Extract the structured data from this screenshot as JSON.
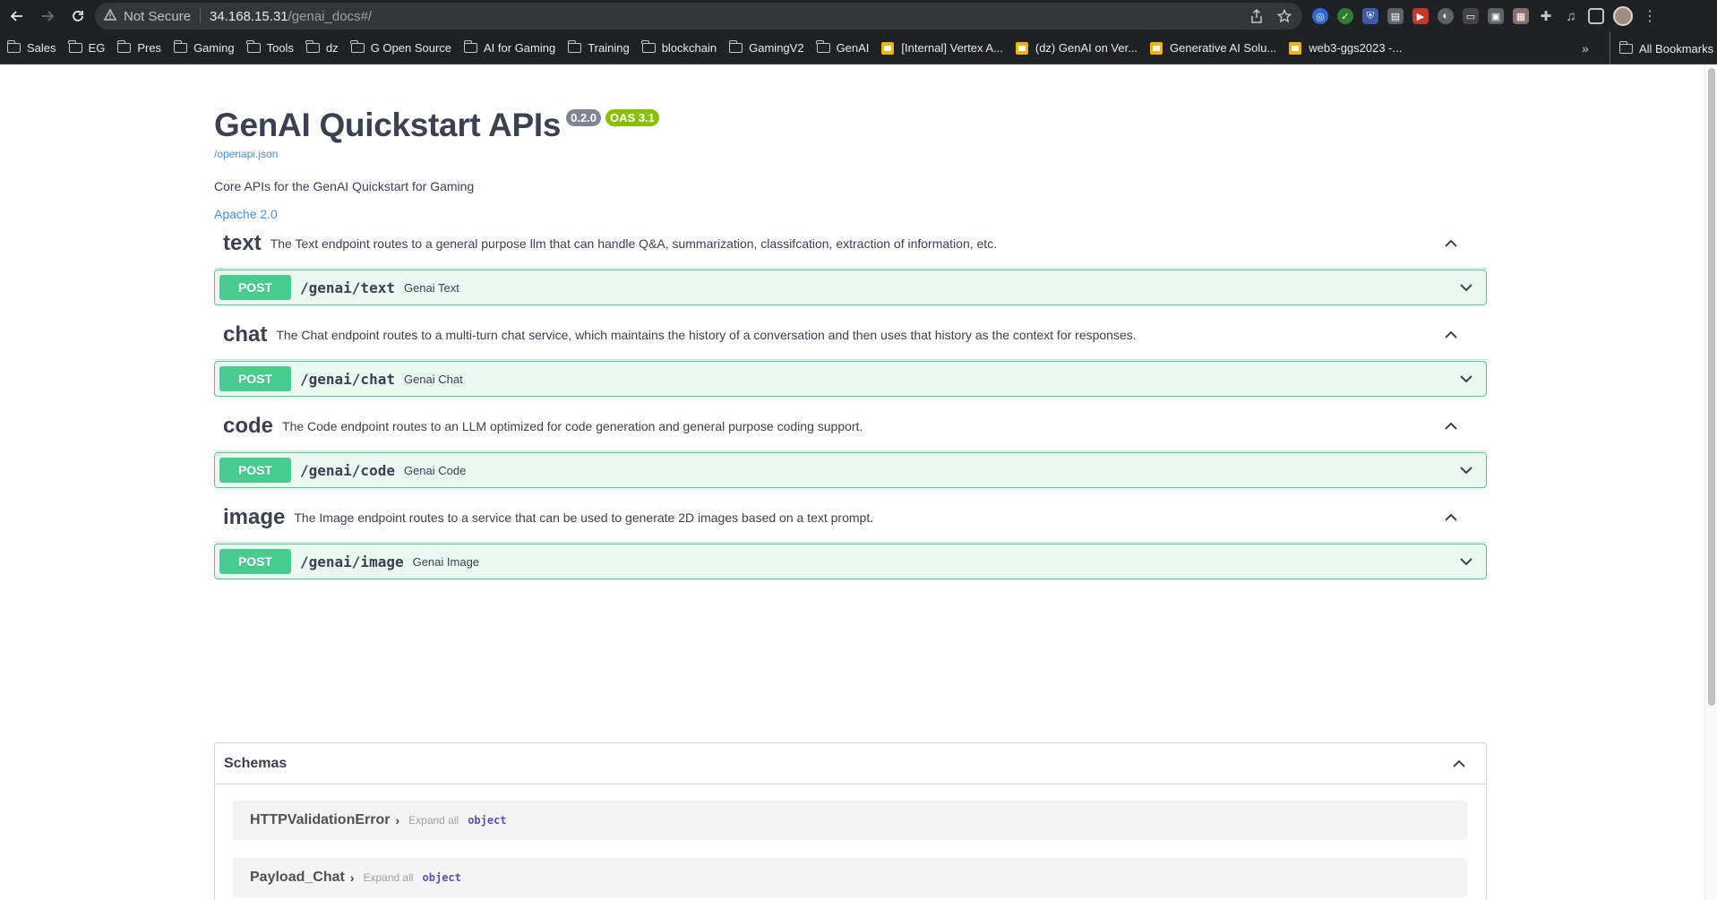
{
  "browser": {
    "security_label": "Not Secure",
    "url_host": "34.168.15.31",
    "url_path": "/genai_docs#/",
    "bookmarks": [
      {
        "label": "Sales",
        "type": "folder"
      },
      {
        "label": "EG",
        "type": "folder"
      },
      {
        "label": "Pres",
        "type": "folder"
      },
      {
        "label": "Gaming",
        "type": "folder"
      },
      {
        "label": "Tools",
        "type": "folder"
      },
      {
        "label": "dz",
        "type": "folder"
      },
      {
        "label": "G Open Source",
        "type": "folder"
      },
      {
        "label": "AI for Gaming",
        "type": "folder"
      },
      {
        "label": "Training",
        "type": "folder"
      },
      {
        "label": "blockchain",
        "type": "folder"
      },
      {
        "label": "GamingV2",
        "type": "folder"
      },
      {
        "label": "GenAI",
        "type": "folder"
      },
      {
        "label": "[Internal] Vertex A...",
        "type": "slides"
      },
      {
        "label": "(dz) GenAI on Ver...",
        "type": "slides"
      },
      {
        "label": "Generative AI Solu...",
        "type": "slides"
      },
      {
        "label": "web3-ggs2023 -...",
        "type": "slides"
      }
    ],
    "more_label": "»",
    "all_bookmarks_label": "All Bookmarks"
  },
  "info": {
    "title": "GenAI Quickstart APIs",
    "version": "0.2.0",
    "oas": "OAS 3.1",
    "spec_link": "/openapi.json",
    "description": "Core APIs for the GenAI Quickstart for Gaming",
    "license": "Apache 2.0"
  },
  "tags": [
    {
      "name": "text",
      "description": "The Text endpoint routes to a general purpose llm that can handle Q&A, summarization, classifcation, extraction of information, etc.",
      "operation": {
        "method": "POST",
        "path": "/genai/text",
        "summary": "Genai Text"
      }
    },
    {
      "name": "chat",
      "description": "The Chat endpoint routes to a multi-turn chat service, which maintains the history of a conversation and then uses that history as the context for responses.",
      "operation": {
        "method": "POST",
        "path": "/genai/chat",
        "summary": "Genai Chat"
      }
    },
    {
      "name": "code",
      "description": "The Code endpoint routes to an LLM optimized for code generation and general purpose coding support.",
      "operation": {
        "method": "POST",
        "path": "/genai/code",
        "summary": "Genai Code"
      }
    },
    {
      "name": "image",
      "description": "The Image endpoint routes to a service that can be used to generate 2D images based on a text prompt.",
      "operation": {
        "method": "POST",
        "path": "/genai/image",
        "summary": "Genai Image"
      }
    }
  ],
  "schemas": {
    "title": "Schemas",
    "models": [
      {
        "name": "HTTPValidationError",
        "expand_label": "Expand all",
        "type": "object"
      },
      {
        "name": "Payload_Chat",
        "expand_label": "Expand all",
        "type": "object"
      }
    ]
  },
  "colors": {
    "post": "#49cc90",
    "post_bg": "#ebf7f1",
    "link": "#4990e2",
    "version_badge": "#7d8492",
    "oas_badge": "#89bf04"
  }
}
